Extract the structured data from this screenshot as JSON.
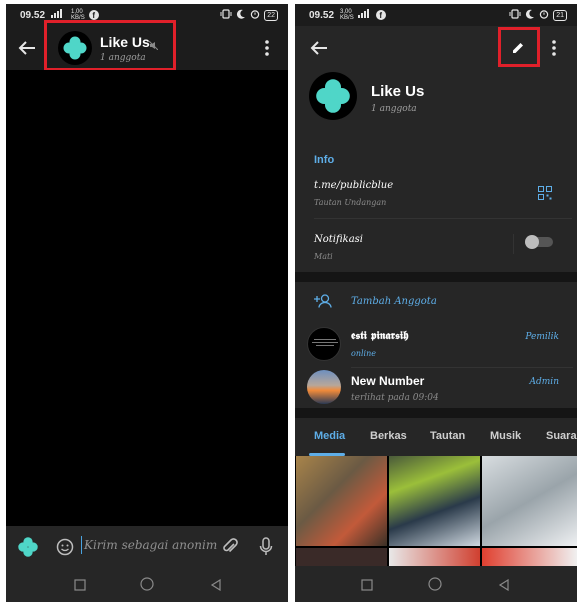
{
  "left_phone": {
    "status": {
      "time": "09.52",
      "net_top": "1,00",
      "net_bottom": "KB/S",
      "battery": "22"
    },
    "header": {
      "title": "Like Us",
      "subtitle": "1 anggota"
    },
    "composer": {
      "placeholder": "Kirim sebagai anonim"
    }
  },
  "right_phone": {
    "status": {
      "time": "09.52",
      "net_top": "3,00",
      "net_bottom": "KB/S",
      "battery": "21"
    },
    "profile": {
      "name": "Like Us",
      "subtitle": "1 anggota"
    },
    "info": {
      "title": "Info",
      "link": "t.me/publicblue",
      "link_label": "Tautan Undangan",
      "notif_title": "Notifikasi",
      "notif_value": "Mati"
    },
    "members": {
      "add_label": "Tambah Anggota",
      "list": [
        {
          "name": "𝖊𝖘𝖙𝖎 𝖕𝖎𝖓𝖆𝖗𝖘𝖎𝖍",
          "status": "online",
          "role": "Pemilik"
        },
        {
          "name": "New Number",
          "status": "terlihat pada   09:04",
          "role": "Admin"
        }
      ]
    },
    "tabs": [
      "Media",
      "Berkas",
      "Tautan",
      "Musik",
      "Suara"
    ]
  },
  "colors": {
    "accent": "#5eaee8",
    "highlight": "#e0202a",
    "clover": "#4fd6c8"
  }
}
